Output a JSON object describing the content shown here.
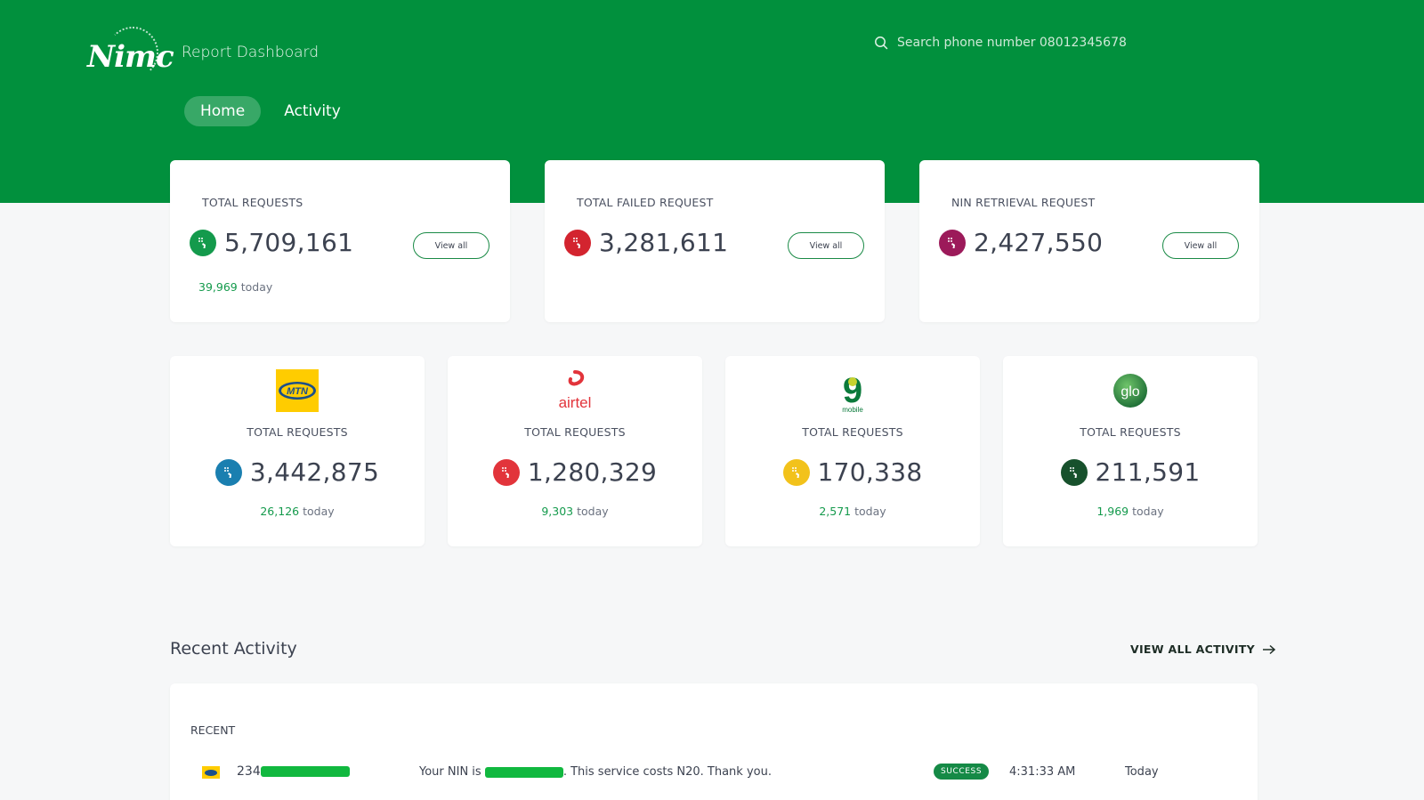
{
  "header": {
    "logo_text": "Nimc",
    "title": "Report Dashboard",
    "search_placeholder": "Search phone number 08012345678",
    "nav": [
      {
        "label": "Home",
        "active": true
      },
      {
        "label": "Activity",
        "active": false
      }
    ],
    "brand_color": "#01903d"
  },
  "summary_cards": [
    {
      "label": "TOTAL REQUESTS",
      "value": "5,709,161",
      "today_count": "39,969",
      "today_label": "today",
      "icon": "sim-card-icon",
      "icon_color": "#149a4c",
      "button_label": "View all"
    },
    {
      "label": "TOTAL FAILED REQUEST",
      "value": "3,281,611",
      "icon": "sim-card-icon",
      "icon_color": "#d3242f",
      "button_label": "View all"
    },
    {
      "label": "NIN RETRIEVAL REQUEST",
      "value": "2,427,550",
      "icon": "sim-card-icon",
      "icon_color": "#9c1a5a",
      "button_label": "View all"
    }
  ],
  "network_cards": [
    {
      "network": "MTN",
      "label": "TOTAL REQUESTS",
      "value": "3,442,875",
      "today_count": "26,126",
      "today_label": "today",
      "icon_color": "#1a7fb0",
      "logo_text": "MTN"
    },
    {
      "network": "airtel",
      "label": "TOTAL REQUESTS",
      "value": "1,280,329",
      "today_count": "9,303",
      "today_label": "today",
      "icon_color": "#e2343b",
      "logo_text": "airtel"
    },
    {
      "network": "9mobile",
      "label": "TOTAL REQUESTS",
      "value": "170,338",
      "today_count": "2,571",
      "today_label": "today",
      "icon_color": "#f2c21b",
      "logo_text": "9",
      "logo_subtext": "mobile"
    },
    {
      "network": "glo",
      "label": "TOTAL REQUESTS",
      "value": "211,591",
      "today_count": "1,969",
      "today_label": "today",
      "icon_color": "#17512c",
      "logo_text": "glo"
    }
  ],
  "recent_activity": {
    "title": "Recent Activity",
    "view_all_label": "VIEW ALL ACTIVITY",
    "section_label": "RECENT",
    "rows": [
      {
        "network": "MTN",
        "phone_prefix": "234",
        "message_prefix": "Your NIN is",
        "message_suffix": ". This service costs N20. Thank you.",
        "status": "SUCCESS",
        "time": "4:31:33 AM",
        "day": "Today"
      }
    ]
  }
}
